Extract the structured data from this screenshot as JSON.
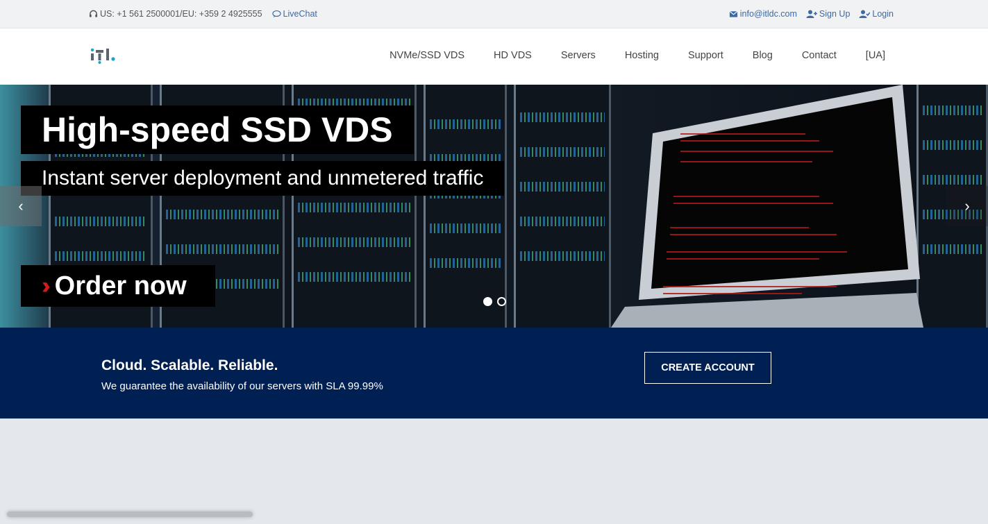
{
  "topbar": {
    "phone": "US: +1 561 2500001/EU: +359 2 4925555",
    "livechat": "LiveChat",
    "email": "info@itldc.com",
    "signup": "Sign Up",
    "login": "Login"
  },
  "nav": {
    "items": [
      {
        "label": "NVMe/SSD VDS"
      },
      {
        "label": "HD VDS"
      },
      {
        "label": "Servers"
      },
      {
        "label": "Hosting"
      },
      {
        "label": "Support"
      },
      {
        "label": "Blog"
      },
      {
        "label": "Contact"
      },
      {
        "label": "[UA]"
      }
    ]
  },
  "hero": {
    "title": "High-speed SSD VDS",
    "subtitle": "Instant server deployment and unmetered traffic",
    "order_label": "Order now",
    "prev": "‹",
    "next": "›",
    "slides_total": 2,
    "active_slide": 1
  },
  "cta": {
    "heading": "Cloud. Scalable. Reliable.",
    "text": "We guarantee the availability of our servers with SLA 99.99%",
    "button": "CREATE ACCOUNT"
  },
  "colors": {
    "brand_navy": "#001f53",
    "link_blue": "#3a6aa8",
    "accent_red": "#d31a1a",
    "logo_teal": "#1aa3c8"
  }
}
